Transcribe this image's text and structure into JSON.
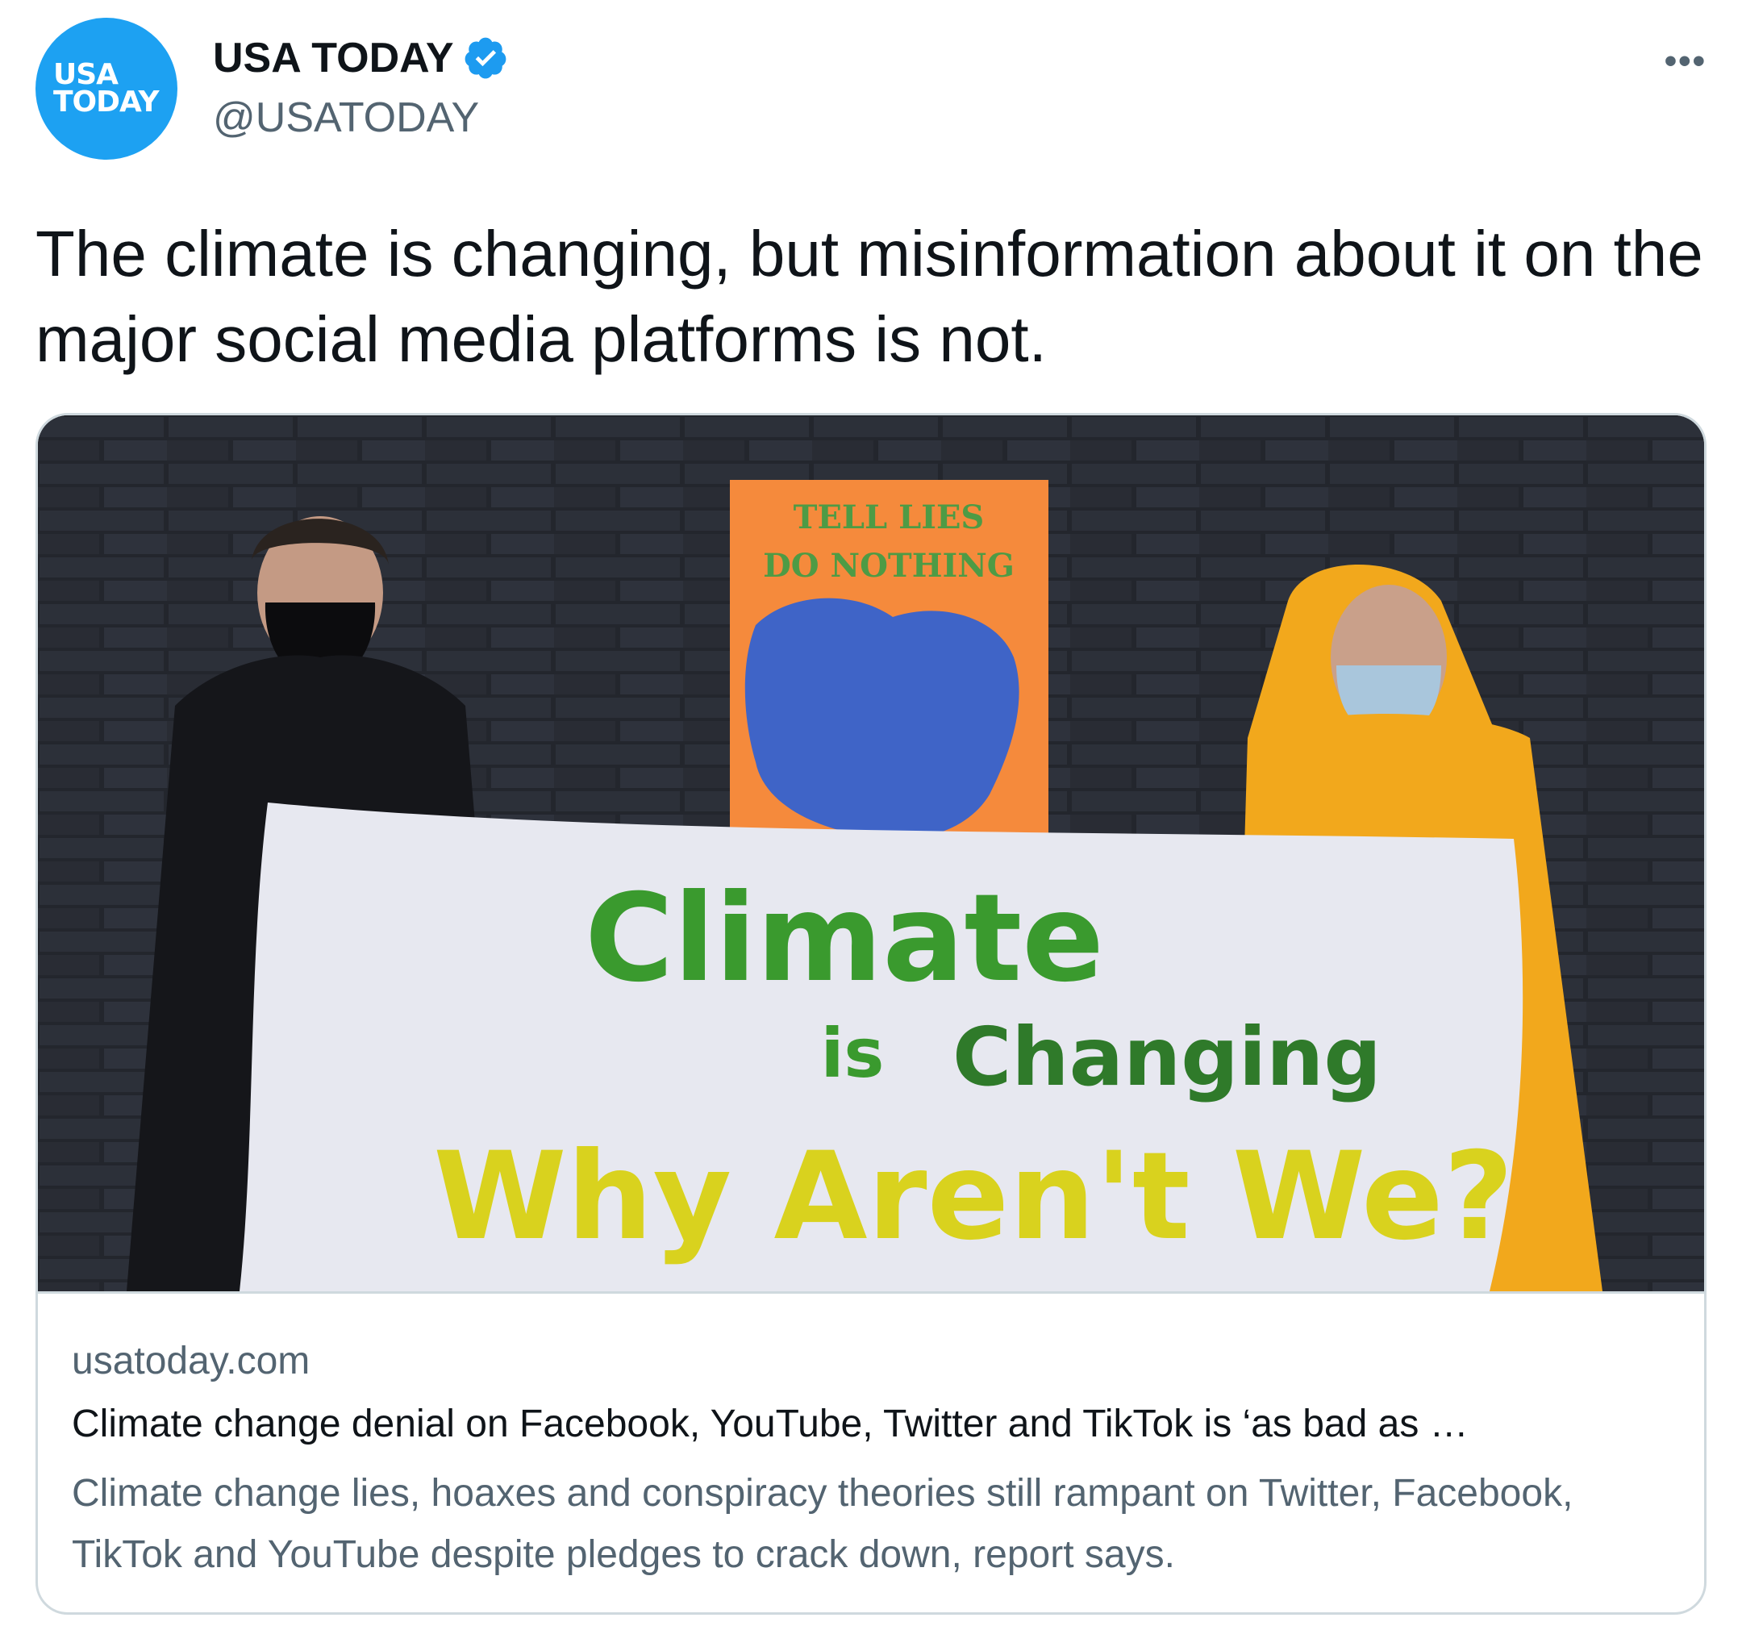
{
  "author": {
    "avatar_line1": "USA",
    "avatar_line2": "TODAY",
    "display_name": "USA TODAY",
    "handle": "@USATODAY",
    "verified_icon": "verified-badge-icon"
  },
  "menu": {
    "more_label": "•••"
  },
  "tweet": {
    "text": "The climate is changing, but misinformation about it on the major social media platforms is not."
  },
  "card": {
    "domain": "usatoday.com",
    "title": "Climate change denial on Facebook, YouTube, Twitter and TikTok is ‘as bad as …",
    "description": "Climate change lies, hoaxes and conspiracy theories still rampant on Twitter, Facebook, TikTok and YouTube despite pledges to crack down, report says.",
    "image": {
      "poster_line1": "TELL LIES",
      "poster_line2": "DO NOTHING",
      "banner_line1": "Climate",
      "banner_line2a": "is",
      "banner_line2b": "Changing",
      "banner_line3": "Why Aren't We?"
    }
  },
  "colors": {
    "brand": "#1da1f2",
    "secondary_text": "#536471",
    "border": "#cfd9de",
    "banner_green": "#3a9a2e",
    "banner_yellow": "#d9d21e",
    "poster_orange": "#f58a3c",
    "poster_blue": "#2b5fd6",
    "jacket_yellow": "#f2a81c"
  }
}
